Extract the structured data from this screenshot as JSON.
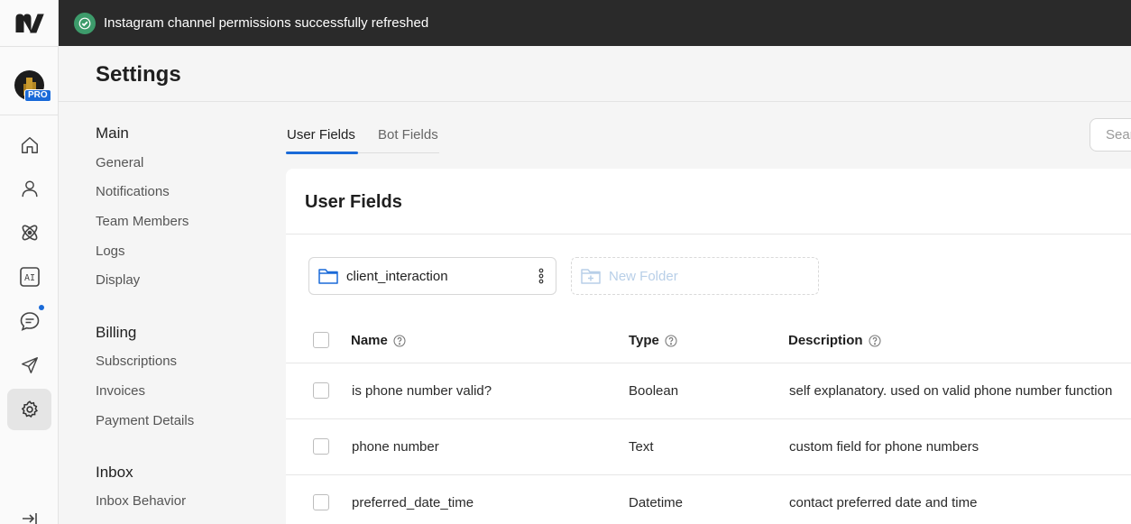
{
  "toast": {
    "message": "Instagram channel permissions successfully refreshed"
  },
  "avatar": {
    "badge": "PRO"
  },
  "rail": {
    "items": [
      {
        "icon": "home-icon"
      },
      {
        "icon": "user-icon"
      },
      {
        "icon": "automation-icon"
      },
      {
        "icon": "ai-icon"
      },
      {
        "icon": "chat-icon"
      },
      {
        "icon": "broadcast-icon"
      },
      {
        "icon": "gear-icon",
        "active": true
      }
    ],
    "collapse_icon": "collapse-icon"
  },
  "header": {
    "title": "Settings"
  },
  "settings_nav": {
    "sections": [
      {
        "heading": "Main",
        "items": [
          "General",
          "Notifications",
          "Team Members",
          "Logs",
          "Display"
        ]
      },
      {
        "heading": "Billing",
        "items": [
          "Subscriptions",
          "Invoices",
          "Payment Details"
        ]
      },
      {
        "heading": "Inbox",
        "items": [
          "Inbox Behavior"
        ]
      }
    ]
  },
  "tabs": [
    {
      "label": "User Fields",
      "active": true
    },
    {
      "label": "Bot Fields",
      "active": false
    }
  ],
  "search": {
    "placeholder": "Search"
  },
  "card": {
    "title": "User Fields",
    "folder": {
      "name": "client_interaction"
    },
    "new_folder_label": "New Folder",
    "columns": {
      "name": "Name",
      "type": "Type",
      "description": "Description"
    },
    "rows": [
      {
        "name": "is phone number valid?",
        "type": "Boolean",
        "description": "self explanatory. used on valid phone number function"
      },
      {
        "name": "phone number",
        "type": "Text",
        "description": "custom field for phone numbers"
      },
      {
        "name": "preferred_date_time",
        "type": "Datetime",
        "description": "contact preferred date and time"
      }
    ]
  },
  "colors": {
    "accent": "#1a6ad8",
    "toast_bg": "#2a2a2a",
    "toast_success": "#3d9b6b"
  }
}
